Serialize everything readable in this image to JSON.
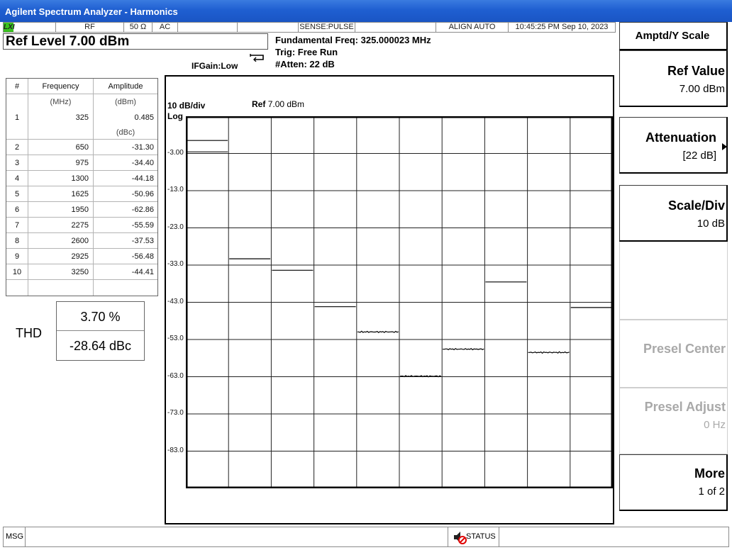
{
  "window": {
    "title": "Agilent Spectrum Analyzer - Harmonics"
  },
  "status_bar": {
    "lxi": "LXI",
    "rf": "RF",
    "impedance": "50 Ω",
    "coupling": "AC",
    "sense": "SENSE:PULSE",
    "align": "ALIGN AUTO",
    "datetime": "10:45:25 PM Sep 10, 2023"
  },
  "header": {
    "ref_level": "Ref Level 7.00 dBm",
    "if_gain": "IFGain:Low",
    "fundamental": "Fundamental Freq: 325.000023 MHz",
    "trig": "Trig: Free Run",
    "atten": "#Atten: 22 dB"
  },
  "table": {
    "headers": {
      "num": "#",
      "freq": "Frequency",
      "amp": "Amplitude",
      "freq_unit": "(MHz)",
      "amp_unit": "(dBm)",
      "rel_unit": "(dBc)"
    },
    "fundamental": {
      "num": "1",
      "freq": "325",
      "amp": "0.485"
    },
    "rows": [
      {
        "num": "2",
        "freq": "650",
        "amp": "-31.30"
      },
      {
        "num": "3",
        "freq": "975",
        "amp": "-34.40"
      },
      {
        "num": "4",
        "freq": "1300",
        "amp": "-44.18"
      },
      {
        "num": "5",
        "freq": "1625",
        "amp": "-50.96"
      },
      {
        "num": "6",
        "freq": "1950",
        "amp": "-62.86"
      },
      {
        "num": "7",
        "freq": "2275",
        "amp": "-55.59"
      },
      {
        "num": "8",
        "freq": "2600",
        "amp": "-37.53"
      },
      {
        "num": "9",
        "freq": "2925",
        "amp": "-56.48"
      },
      {
        "num": "10",
        "freq": "3250",
        "amp": "-44.41"
      }
    ]
  },
  "thd": {
    "label": "THD",
    "percent": "3.70 %",
    "dbc": "-28.64 dBc"
  },
  "display": {
    "scale": "10 dB/div",
    "scale_type": "Log",
    "ref_prefix": "Ref",
    "ref_value": "7.00 dBm",
    "tick_labels": [
      "-3.00",
      "-13.0",
      "-23.0",
      "-33.0",
      "-43.0",
      "-53.0",
      "-63.0",
      "-73.0",
      "-83.0"
    ]
  },
  "chart_data": {
    "type": "bar",
    "title": "",
    "ylabel": "10 dB/div",
    "ylim": [
      -93,
      7
    ],
    "categories": [
      "1",
      "2",
      "3",
      "4",
      "5",
      "6",
      "7",
      "8",
      "9",
      "10"
    ],
    "values": [
      0.485,
      -31.3,
      -34.4,
      -44.18,
      -50.96,
      -62.86,
      -55.59,
      -37.53,
      -56.48,
      -44.41
    ],
    "grid": true
  },
  "softkeys": {
    "menu_title": "Amptd/Y Scale",
    "ref_value": {
      "label": "Ref Value",
      "value": "7.00 dBm"
    },
    "attenuation": {
      "label": "Attenuation",
      "value": "[22 dB]"
    },
    "scale_div": {
      "label": "Scale/Div",
      "value": "10 dB"
    },
    "presel_center": {
      "label": "Presel Center"
    },
    "presel_adjust": {
      "label": "Presel Adjust",
      "value": "0 Hz"
    },
    "more": {
      "label": "More",
      "value": "1 of 2"
    }
  },
  "bottom": {
    "msg": "MSG",
    "status": "STATUS"
  }
}
